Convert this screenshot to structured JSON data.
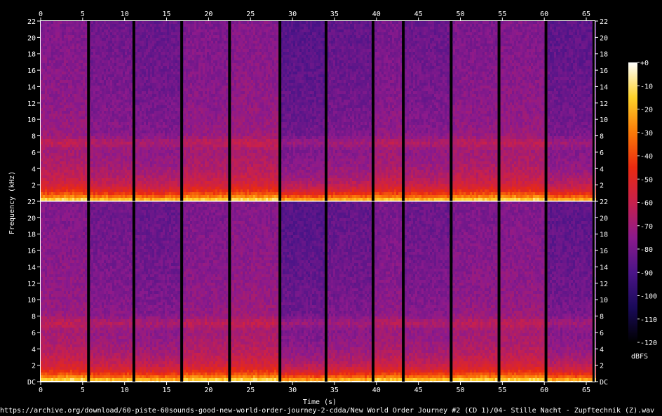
{
  "chart_data": {
    "type": "heatmap",
    "subtype": "spectrogram",
    "channels": 2,
    "xlabel": "Time (s)",
    "ylabel": "Frequency (kHz)",
    "xlim": [
      0,
      66
    ],
    "ylim": [
      0,
      22
    ],
    "x_ticks": [
      0,
      5,
      10,
      15,
      20,
      25,
      30,
      35,
      40,
      45,
      50,
      55,
      60,
      65
    ],
    "y_ticks": [
      {
        "value": 22,
        "label": "22"
      },
      {
        "value": 20,
        "label": "20"
      },
      {
        "value": 18,
        "label": "18"
      },
      {
        "value": 16,
        "label": "16"
      },
      {
        "value": 14,
        "label": "14"
      },
      {
        "value": 12,
        "label": "12"
      },
      {
        "value": 10,
        "label": "10"
      },
      {
        "value": 8,
        "label": "8"
      },
      {
        "value": 6,
        "label": "6"
      },
      {
        "value": 4,
        "label": "4"
      },
      {
        "value": 2,
        "label": "2"
      }
    ],
    "bottom_tick_label": "DC",
    "colorbar": {
      "unit": "dBFS",
      "range": [
        -120,
        0
      ],
      "ticks": [
        {
          "value": 0,
          "label": "+0"
        },
        {
          "value": -10,
          "label": "-10"
        },
        {
          "value": -20,
          "label": "-20"
        },
        {
          "value": -30,
          "label": "-30"
        },
        {
          "value": -40,
          "label": "-40"
        },
        {
          "value": -50,
          "label": "-50"
        },
        {
          "value": -60,
          "label": "-60"
        },
        {
          "value": -70,
          "label": "-70"
        },
        {
          "value": -80,
          "label": "-80"
        },
        {
          "value": -90,
          "label": "-90"
        },
        {
          "value": -100,
          "label": "-100"
        },
        {
          "value": -110,
          "label": "-110"
        },
        {
          "value": -120,
          "label": "-120"
        }
      ],
      "colors": [
        "#000000",
        "#1a0a5a",
        "#4b1488",
        "#8c1a8c",
        "#c8204c",
        "#ea2a10",
        "#fb7a08",
        "#fdd22a",
        "#ffffff"
      ]
    },
    "silence_gaps_s": [
      5.7,
      11.1,
      16.8,
      22.5,
      28.5,
      34.0,
      39.6,
      43.2,
      48.9,
      54.6,
      60.2,
      65.9
    ],
    "segments": [
      {
        "start": 0.0,
        "end": 5.7,
        "level_db": -72
      },
      {
        "start": 5.7,
        "end": 11.1,
        "level_db": -76
      },
      {
        "start": 11.1,
        "end": 16.8,
        "level_db": -78
      },
      {
        "start": 16.8,
        "end": 22.5,
        "level_db": -73
      },
      {
        "start": 22.5,
        "end": 28.5,
        "level_db": -71
      },
      {
        "start": 28.5,
        "end": 34.0,
        "level_db": -82
      },
      {
        "start": 34.0,
        "end": 39.6,
        "level_db": -79
      },
      {
        "start": 39.6,
        "end": 43.2,
        "level_db": -74
      },
      {
        "start": 43.2,
        "end": 48.9,
        "level_db": -77
      },
      {
        "start": 48.9,
        "end": 54.6,
        "level_db": -73
      },
      {
        "start": 54.6,
        "end": 60.2,
        "level_db": -72
      },
      {
        "start": 60.2,
        "end": 65.9,
        "level_db": -80
      }
    ]
  },
  "footer": {
    "source": "https://archive.org/download/60-piste-60sounds-good-new-world-order-journey-2-cdda/New World Order Journey #2 (CD 1)/04- Stille Nacht - Zupftechnik (Z).wav"
  }
}
